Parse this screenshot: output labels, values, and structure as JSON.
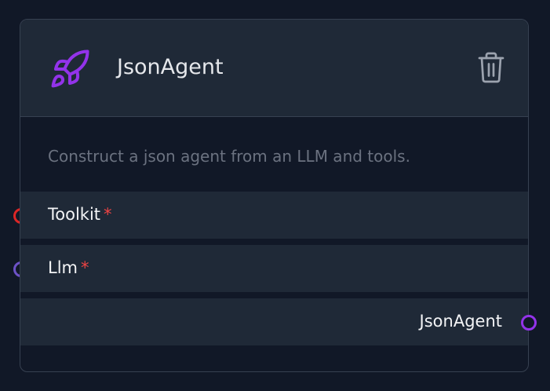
{
  "node": {
    "title": "JsonAgent",
    "icon": "rocket-icon",
    "description": "Construct a json agent from an LLM and tools.",
    "delete_icon": "trash-icon"
  },
  "inputs": [
    {
      "label": "Toolkit",
      "required": "*",
      "handle_color": "#dc2626"
    },
    {
      "label": "Llm",
      "required": "*",
      "handle_color": "#6d52c7"
    }
  ],
  "output": {
    "label": "JsonAgent",
    "handle_color": "#9333ea"
  },
  "colors": {
    "background": "#111827",
    "panel": "#1f2937",
    "accent": "#9333ea",
    "required": "#ef4444"
  }
}
